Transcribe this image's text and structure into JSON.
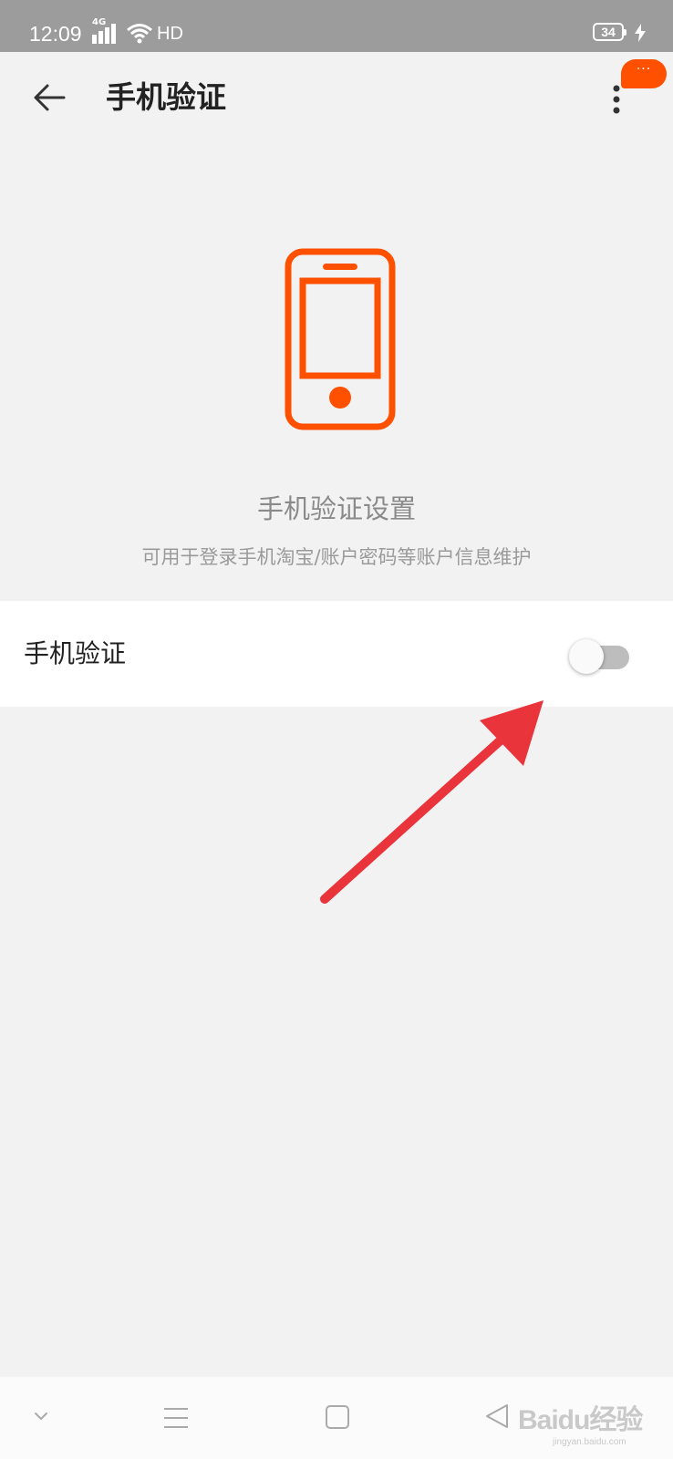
{
  "status_bar": {
    "time": "12:09",
    "network": "4G",
    "hd_label": "HD",
    "battery_level": "34",
    "charging": true,
    "background_color": "#9c9c9c"
  },
  "header": {
    "title": "手机验证",
    "back_icon": "arrow-left-icon",
    "more_icon": "vertical-dots-icon",
    "message_badge": "···",
    "badge_color": "#ff5000"
  },
  "hero": {
    "icon": "smartphone-icon",
    "icon_color": "#ff5000",
    "title": "手机验证设置",
    "subtitle": "可用于登录手机淘宝/账户密码等账户信息维护"
  },
  "settings": {
    "phone_verification": {
      "label": "手机验证",
      "enabled": false
    }
  },
  "annotation": {
    "type": "arrow",
    "color": "#e8343a",
    "points_to": "phone-verification-toggle"
  },
  "nav_bar": {
    "buttons": [
      "collapse-icon",
      "menu-icon",
      "home-square-icon",
      "back-triangle-icon"
    ]
  },
  "watermark": {
    "text": "Baidu经验",
    "sub": "jingyan.baidu.com"
  }
}
